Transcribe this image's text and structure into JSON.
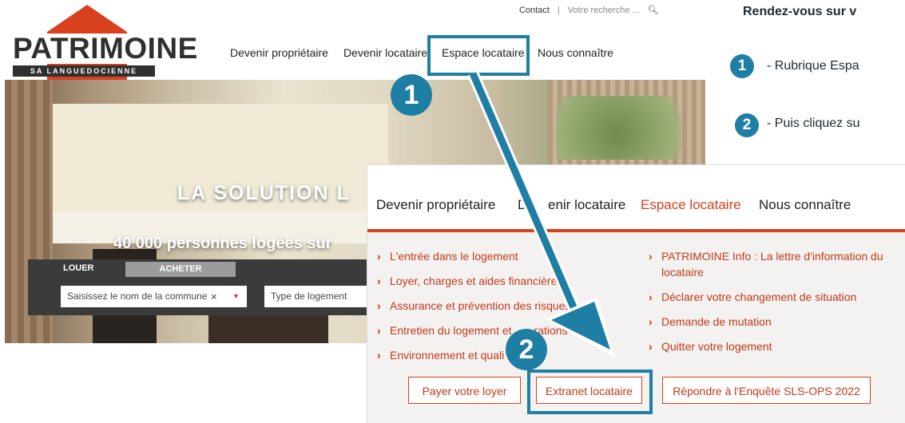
{
  "site": {
    "logo_word": "PATRIMOINE",
    "logo_sub": "SA LANGUEDOCIENNE",
    "top_links": {
      "contact": "Contact",
      "separator": "|",
      "search_placeholder": "Votre recherche ...",
      "search_icon": "search-icon"
    },
    "nav": [
      "Devenir propriétaire",
      "Devenir locataire",
      "Espace locataire",
      "Nous connaître"
    ]
  },
  "hero": {
    "title": "LA SOLUTION L",
    "subtitle": "40 000 personnes logées sur",
    "tabs": [
      "LOUER",
      "ACHETER"
    ],
    "commune_placeholder": "Saisissez le nom de la commune",
    "commune_clear": "×",
    "commune_arrow": "▼",
    "type_placeholder": "Type de logement"
  },
  "instructions": {
    "title": "Rendez-vous sur v",
    "step1_badge": "1",
    "step1_text": "- Rubrique Espa",
    "step2_badge": "2",
    "step2_text": "- Puis cliquez su"
  },
  "annotations": {
    "badge1": "1",
    "badge2": "2"
  },
  "zoom": {
    "nav": [
      "Devenir propriétaire",
      "De",
      "enir locataire",
      "Espace locataire",
      "Nous connaître"
    ],
    "chevron": "›",
    "left_items": [
      "L'entrée dans le logement",
      "Loyer, charges et aides financières",
      "Assurance et prévention des risques",
      "Entretien du logement et",
      "rations",
      "Environnement et quali"
    ],
    "right_items": [
      "PATRIMOINE Info : La lettre d'information du",
      "locataire",
      "Déclarer votre changement de situation",
      "Demande de mutation",
      "Quitter votre logement"
    ],
    "buttons": [
      "Payer votre loyer",
      "Extranet locataire",
      "Répondre à l'Enquête SLS-OPS 2022"
    ]
  },
  "colors": {
    "accent": "#d9401e",
    "highlight": "#1f7ea3",
    "text": "#222222"
  }
}
